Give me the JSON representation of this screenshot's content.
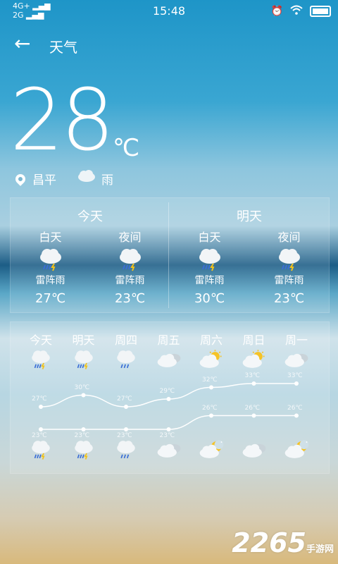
{
  "status": {
    "net1": "4G+",
    "net2": "2G",
    "time": "15:48"
  },
  "header": {
    "title": "天气"
  },
  "current": {
    "temp": "28",
    "unit": "℃",
    "city": "昌平",
    "condition": "雨"
  },
  "today": {
    "title": "今天",
    "day": {
      "label": "白天",
      "cond": "雷阵雨",
      "temp": "27℃",
      "icon": "thunderstorm-icon"
    },
    "night": {
      "label": "夜间",
      "cond": "雷阵雨",
      "temp": "23℃",
      "icon": "thunderstorm-icon"
    }
  },
  "tomorrow": {
    "title": "明天",
    "day": {
      "label": "白天",
      "cond": "雷阵雨",
      "temp": "30℃",
      "icon": "thunderstorm-icon"
    },
    "night": {
      "label": "夜间",
      "cond": "雷阵雨",
      "temp": "23℃",
      "icon": "thunderstorm-icon"
    }
  },
  "week": [
    {
      "day": "今天",
      "high": "27℃",
      "low": "23℃",
      "hi": 27,
      "lo": 23,
      "dayIcon": "thunderstorm-icon",
      "nightIcon": "thunderstorm-icon"
    },
    {
      "day": "明天",
      "high": "30℃",
      "low": "23℃",
      "hi": 30,
      "lo": 23,
      "dayIcon": "thunderstorm-icon",
      "nightIcon": "thunderstorm-icon"
    },
    {
      "day": "周四",
      "high": "27℃",
      "low": "23℃",
      "hi": 27,
      "lo": 23,
      "dayIcon": "rain-icon",
      "nightIcon": "rain-icon"
    },
    {
      "day": "周五",
      "high": "29℃",
      "low": "23℃",
      "hi": 29,
      "lo": 23,
      "dayIcon": "cloudy-icon",
      "nightIcon": "cloudy-icon"
    },
    {
      "day": "周六",
      "high": "32℃",
      "low": "26℃",
      "hi": 32,
      "lo": 26,
      "dayIcon": "partly-sunny-icon",
      "nightIcon": "moon-cloud-icon"
    },
    {
      "day": "周日",
      "high": "33℃",
      "low": "26℃",
      "hi": 33,
      "lo": 26,
      "dayIcon": "partly-sunny-icon",
      "nightIcon": "cloudy-icon"
    },
    {
      "day": "周一",
      "high": "33℃",
      "low": "26℃",
      "hi": 33,
      "lo": 26,
      "dayIcon": "cloudy-icon",
      "nightIcon": "moon-cloud-icon"
    }
  ],
  "watermark": {
    "brand": "2265",
    "suffix": "手游网"
  }
}
